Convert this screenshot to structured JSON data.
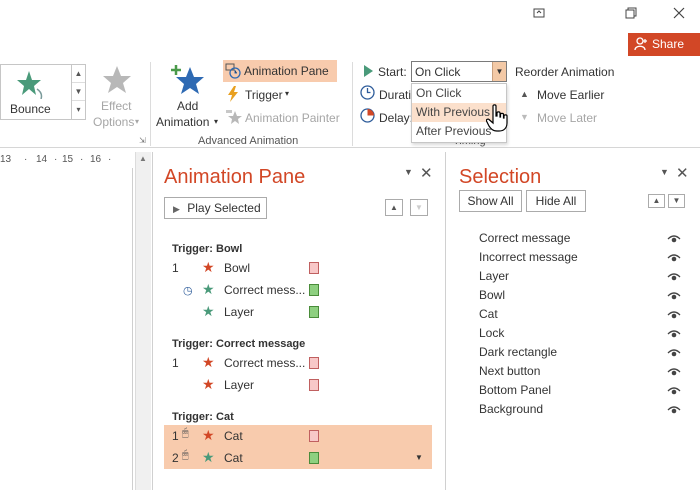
{
  "window": {
    "restore_icon": "restore-down-icon",
    "maximize_icon": "maximize-icon",
    "close_icon": "close-icon",
    "share_label": "Share"
  },
  "ribbon": {
    "gallery": {
      "bounce_label": "Bounce"
    },
    "effect_options": {
      "line1": "Effect",
      "line2": "Options"
    },
    "add_animation": {
      "line1": "Add",
      "line2": "Animation"
    },
    "animation_pane_label": "Animation Pane",
    "trigger_label": "Trigger",
    "animation_painter_label": "Animation Painter",
    "advanced_group_label": "Advanced Animation",
    "start_label": "Start:",
    "start_value": "On Click",
    "duration_label": "Durati",
    "delay_label": "Delay:",
    "start_options": [
      "On Click",
      "With Previous",
      "After Previous"
    ],
    "timing_group_label": "Timing",
    "reorder_label": "Reorder Animation",
    "move_earlier_label": "Move Earlier",
    "move_later_label": "Move Later"
  },
  "ruler": {
    "ticks": [
      "13",
      "14",
      "15",
      "16"
    ]
  },
  "animation_pane": {
    "title": "Animation Pane",
    "play_selected_label": "Play Selected",
    "groups": [
      {
        "header": "Trigger: Bowl",
        "items": [
          {
            "num": "1",
            "label": "Bowl",
            "effect": "exit",
            "box": "red"
          },
          {
            "num": "",
            "label": "Correct mess...",
            "effect": "entrance",
            "box": "green",
            "timing": "with-previous"
          },
          {
            "num": "",
            "label": "Layer",
            "effect": "entrance",
            "box": "green"
          }
        ]
      },
      {
        "header": "Trigger: Correct message",
        "items": [
          {
            "num": "1",
            "label": "Correct mess...",
            "effect": "exit",
            "box": "red"
          },
          {
            "num": "",
            "label": "Layer",
            "effect": "exit",
            "box": "red"
          }
        ]
      },
      {
        "header": "Trigger: Cat",
        "items": [
          {
            "num": "1",
            "label": "Cat",
            "effect": "exit",
            "box": "red",
            "timing": "on-click",
            "selected": true
          },
          {
            "num": "2",
            "label": "Cat",
            "effect": "entrance",
            "box": "green",
            "timing": "on-click",
            "selected": true
          }
        ]
      }
    ]
  },
  "selection_pane": {
    "title": "Selection",
    "show_all_label": "Show All",
    "hide_all_label": "Hide All",
    "items": [
      "Correct message",
      "Incorrect message",
      "Layer",
      "Bowl",
      "Cat",
      "Lock",
      "Dark rectangle",
      "Next button",
      "Bottom Panel",
      "Background"
    ]
  },
  "colors": {
    "accent": "#d24726",
    "highlight": "#f8cbad",
    "exit_star": "#d24726",
    "entrance_star": "#4a9a7a"
  }
}
